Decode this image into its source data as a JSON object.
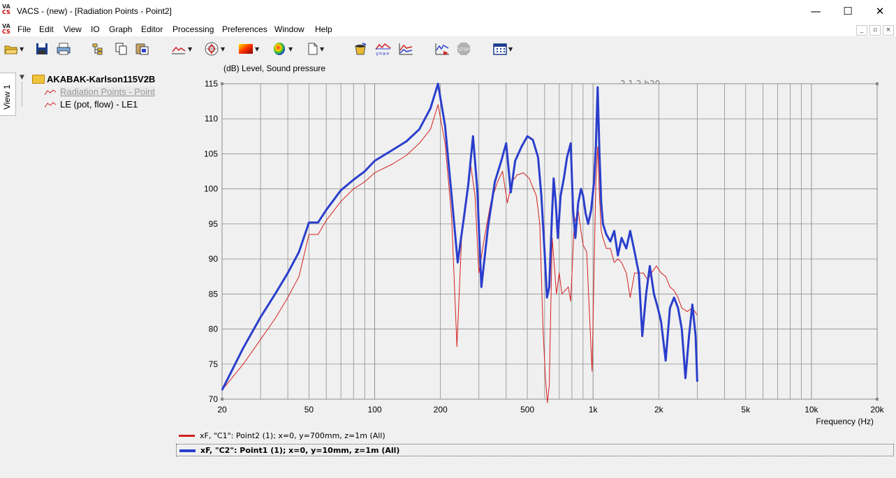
{
  "window": {
    "logo_top": "VA",
    "logo_bottom": "CS",
    "title": "VACS - (new) - [Radiation Points - Point2]",
    "minimize": "—",
    "maximize": "☐",
    "close": "✕"
  },
  "menu": {
    "items": [
      "File",
      "Edit",
      "View",
      "IO",
      "Graph",
      "Editor",
      "Processing",
      "Preferences",
      "Window",
      "Help"
    ],
    "mdi_minimize": "_",
    "mdi_restore": "▫",
    "mdi_close": "×"
  },
  "toolbar": {
    "version": "2.1.2 b20"
  },
  "sidebar": {
    "view_tab": "View 1",
    "root_label": "AKABAK-Karlson115V2B",
    "items": [
      {
        "label": "Radiation Points - Point",
        "selected": true
      },
      {
        "label": "LE (pot, flow) - LE1",
        "selected": false
      }
    ]
  },
  "chart_data": {
    "type": "line",
    "title": "(dB)  Level, Sound pressure",
    "xlabel": "Frequency  (Hz)",
    "ylabel": "(dB)",
    "x_scale": "log",
    "xlim": [
      20,
      20000
    ],
    "ylim": [
      70,
      115
    ],
    "xticks": [
      20,
      50,
      100,
      200,
      500,
      1000,
      2000,
      5000,
      10000,
      20000
    ],
    "xtick_labels": [
      "20",
      "50",
      "100",
      "200",
      "500",
      "1k",
      "2k",
      "5k",
      "10k",
      "20k"
    ],
    "yticks": [
      70,
      75,
      80,
      85,
      90,
      95,
      100,
      105,
      110,
      115
    ],
    "ytick_labels": [
      "70",
      "75",
      "80",
      "85",
      "90",
      "95",
      "100",
      "105",
      "110",
      "115"
    ],
    "grid": true,
    "series": [
      {
        "name": "xF, \"C1\": Point2 (1); x=0, y=700mm, z=1m  (All)",
        "color": "#d42020",
        "width": 1,
        "points": [
          [
            20,
            71.3
          ],
          [
            25,
            75
          ],
          [
            30,
            78.5
          ],
          [
            35,
            81.5
          ],
          [
            40,
            84.5
          ],
          [
            45,
            87.5
          ],
          [
            50,
            93.5
          ],
          [
            55,
            93.5
          ],
          [
            60,
            95.5
          ],
          [
            70,
            98.2
          ],
          [
            80,
            100
          ],
          [
            90,
            101
          ],
          [
            100,
            102.3
          ],
          [
            120,
            103.5
          ],
          [
            140,
            104.8
          ],
          [
            160,
            106.5
          ],
          [
            180,
            108.5
          ],
          [
            195,
            112
          ],
          [
            210,
            106.5
          ],
          [
            225,
            96
          ],
          [
            238,
            77.5
          ],
          [
            250,
            93
          ],
          [
            262,
            98.5
          ],
          [
            275,
            103.5
          ],
          [
            288,
            99
          ],
          [
            300,
            88
          ],
          [
            318,
            93
          ],
          [
            340,
            98
          ],
          [
            365,
            101
          ],
          [
            385,
            102.5
          ],
          [
            405,
            98
          ],
          [
            425,
            101
          ],
          [
            450,
            102
          ],
          [
            480,
            102.3
          ],
          [
            510,
            101.5
          ],
          [
            550,
            99
          ],
          [
            570,
            95
          ],
          [
            590,
            80
          ],
          [
            605,
            73
          ],
          [
            618,
            69.5
          ],
          [
            630,
            72
          ],
          [
            650,
            93
          ],
          [
            665,
            89
          ],
          [
            680,
            85
          ],
          [
            700,
            88
          ],
          [
            720,
            85
          ],
          [
            745,
            85.5
          ],
          [
            770,
            86
          ],
          [
            790,
            84
          ],
          [
            820,
            95
          ],
          [
            855,
            97
          ],
          [
            880,
            94
          ],
          [
            900,
            92
          ],
          [
            935,
            91
          ],
          [
            960,
            83
          ],
          [
            990,
            74
          ],
          [
            1010,
            88
          ],
          [
            1030,
            101
          ],
          [
            1050,
            106
          ],
          [
            1070,
            99
          ],
          [
            1090,
            94
          ],
          [
            1110,
            93
          ],
          [
            1150,
            91.5
          ],
          [
            1200,
            91.5
          ],
          [
            1250,
            89.5
          ],
          [
            1300,
            90
          ],
          [
            1350,
            89.5
          ],
          [
            1420,
            88
          ],
          [
            1480,
            84.5
          ],
          [
            1550,
            88
          ],
          [
            1620,
            88
          ],
          [
            1700,
            88
          ],
          [
            1780,
            87
          ],
          [
            1850,
            88
          ],
          [
            1950,
            89
          ],
          [
            2050,
            88
          ],
          [
            2150,
            87.5
          ],
          [
            2250,
            86
          ],
          [
            2350,
            85.5
          ],
          [
            2450,
            84.5
          ],
          [
            2550,
            83
          ],
          [
            2700,
            82.5
          ],
          [
            2850,
            83
          ],
          [
            3000,
            82
          ]
        ]
      },
      {
        "name": "xF, \"C2\": Point1 (1); x=0, y=10mm, z=1m  (All)",
        "color": "#2a3ecc",
        "width": 3,
        "points": [
          [
            20,
            71.3
          ],
          [
            25,
            77.3
          ],
          [
            30,
            81.7
          ],
          [
            35,
            85
          ],
          [
            40,
            88
          ],
          [
            45,
            91
          ],
          [
            50,
            95.2
          ],
          [
            55,
            95.2
          ],
          [
            60,
            97
          ],
          [
            70,
            99.8
          ],
          [
            80,
            101.3
          ],
          [
            90,
            102.5
          ],
          [
            100,
            104
          ],
          [
            120,
            105.5
          ],
          [
            140,
            106.8
          ],
          [
            160,
            108.5
          ],
          [
            180,
            111.5
          ],
          [
            195,
            115
          ],
          [
            210,
            109
          ],
          [
            225,
            99
          ],
          [
            240,
            89.5
          ],
          [
            255,
            95.5
          ],
          [
            268,
            100.5
          ],
          [
            282,
            107.5
          ],
          [
            295,
            100
          ],
          [
            308,
            86
          ],
          [
            330,
            94.5
          ],
          [
            355,
            101
          ],
          [
            380,
            104
          ],
          [
            400,
            106.5
          ],
          [
            420,
            99.5
          ],
          [
            440,
            104
          ],
          [
            470,
            106
          ],
          [
            500,
            107.5
          ],
          [
            530,
            107
          ],
          [
            560,
            104.5
          ],
          [
            580,
            99
          ],
          [
            600,
            91
          ],
          [
            615,
            84.5
          ],
          [
            630,
            86
          ],
          [
            648,
            96
          ],
          [
            660,
            101.5
          ],
          [
            675,
            98
          ],
          [
            690,
            93
          ],
          [
            710,
            99
          ],
          [
            735,
            101.5
          ],
          [
            760,
            104.5
          ],
          [
            790,
            106.5
          ],
          [
            810,
            97
          ],
          [
            830,
            93
          ],
          [
            855,
            98
          ],
          [
            880,
            100
          ],
          [
            900,
            99
          ],
          [
            925,
            96.5
          ],
          [
            950,
            95
          ],
          [
            980,
            97
          ],
          [
            1010,
            101
          ],
          [
            1030,
            106
          ],
          [
            1050,
            114.5
          ],
          [
            1070,
            105
          ],
          [
            1090,
            98
          ],
          [
            1110,
            95
          ],
          [
            1150,
            93.5
          ],
          [
            1200,
            92.5
          ],
          [
            1250,
            94
          ],
          [
            1300,
            90.5
          ],
          [
            1350,
            93
          ],
          [
            1420,
            91.5
          ],
          [
            1480,
            94
          ],
          [
            1550,
            91
          ],
          [
            1620,
            88
          ],
          [
            1680,
            79
          ],
          [
            1750,
            85
          ],
          [
            1820,
            89
          ],
          [
            1900,
            85
          ],
          [
            1980,
            83
          ],
          [
            2050,
            81
          ],
          [
            2150,
            75.5
          ],
          [
            2250,
            83
          ],
          [
            2350,
            84.5
          ],
          [
            2450,
            83
          ],
          [
            2550,
            80
          ],
          [
            2650,
            73
          ],
          [
            2750,
            79
          ],
          [
            2850,
            83.5
          ],
          [
            2950,
            79
          ],
          [
            3000,
            72.5
          ]
        ]
      }
    ]
  }
}
